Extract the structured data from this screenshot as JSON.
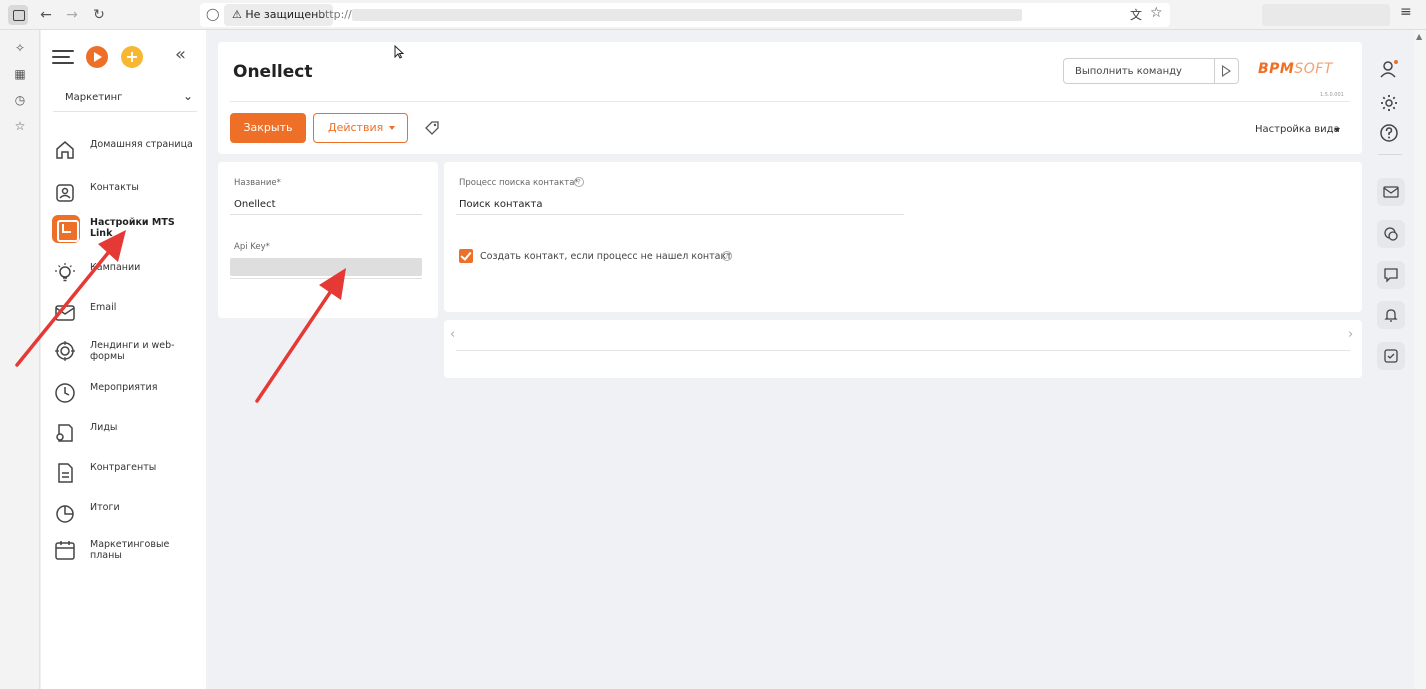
{
  "browser": {
    "security_label": "Не защищено",
    "url_prefix": "http://",
    "icons": [
      "sidebar-toggle-icon",
      "back-icon",
      "forward-icon",
      "reload-icon",
      "shield-icon",
      "translate-icon",
      "bookmark-star-icon",
      "menu-icon"
    ]
  },
  "browser_side": {
    "icons": [
      "sparkle-icon",
      "tab-icon",
      "history-icon",
      "favorites-icon"
    ]
  },
  "nav": {
    "section": "Маркетинг",
    "items": [
      {
        "label": "Домашняя страница",
        "icon": "home-icon"
      },
      {
        "label": "Контакты",
        "icon": "contacts-icon"
      },
      {
        "label": "Настройки MTS Link",
        "icon": "mts-link-icon",
        "active": true
      },
      {
        "label": "Кампании",
        "icon": "bulb-icon"
      },
      {
        "label": "Email",
        "icon": "email-icon"
      },
      {
        "label": "Лендинги и web-формы",
        "icon": "target-icon"
      },
      {
        "label": "Мероприятия",
        "icon": "clock-icon"
      },
      {
        "label": "Лиды",
        "icon": "leads-icon"
      },
      {
        "label": "Контрагенты",
        "icon": "document-icon"
      },
      {
        "label": "Итоги",
        "icon": "pie-chart-icon"
      },
      {
        "label": "Маркетинговые планы",
        "icon": "calendar-icon"
      }
    ]
  },
  "header": {
    "title": "Onellect",
    "command_placeholder": "Выполнить команду",
    "brand_main": "BPM",
    "brand_soft": "SOFT",
    "version": "1.5.0.001",
    "close_label": "Закрыть",
    "actions_label": "Действия",
    "view_settings_label": "Настройка вида"
  },
  "left_card": {
    "name_label": "Название*",
    "name_value": "Onellect",
    "api_key_label": "Api Key*"
  },
  "right_card": {
    "process_label": "Процесс поиска контакта*",
    "process_value": "Поиск контакта",
    "create_contact_label": "Создать контакт, если процесс не нашел контакт",
    "create_contact_checked": true
  },
  "theme": {
    "accent": "#ee7028",
    "annotation": "#e53935"
  }
}
